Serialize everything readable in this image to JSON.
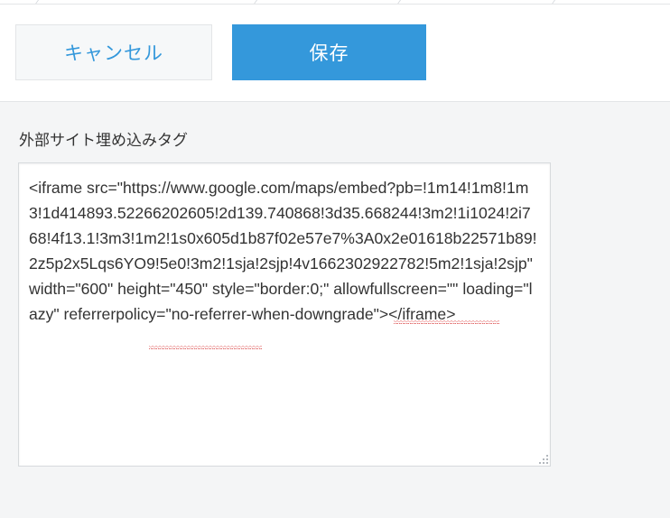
{
  "toolbar": {
    "cancel_label": "キャンセル",
    "save_label": "保存"
  },
  "embed_field": {
    "label": "外部サイト埋め込みタグ",
    "value": "<iframe src=\"https://www.google.com/maps/embed?pb=!1m14!1m8!1m3!1d414893.52266202605!2d139.740868!3d35.668244!3m2!1i1024!2i768!4f13.1!3m3!1m2!1s0x605d1b87f02e57e7%3A0x2e01618b22571b89!2z5p2x5Lqs6YO9!5e0!3m2!1sja!2sjp!4v1662302922782!5m2!1sja!2sjp\" width=\"600\" height=\"450\" style=\"border:0;\" allowfullscreen=\"\" loading=\"lazy\" referrerpolicy=\"no-referrer-when-downgrade\"></iframe>"
  },
  "colors": {
    "accent": "#3498db",
    "page_background": "#f4f5f6"
  }
}
